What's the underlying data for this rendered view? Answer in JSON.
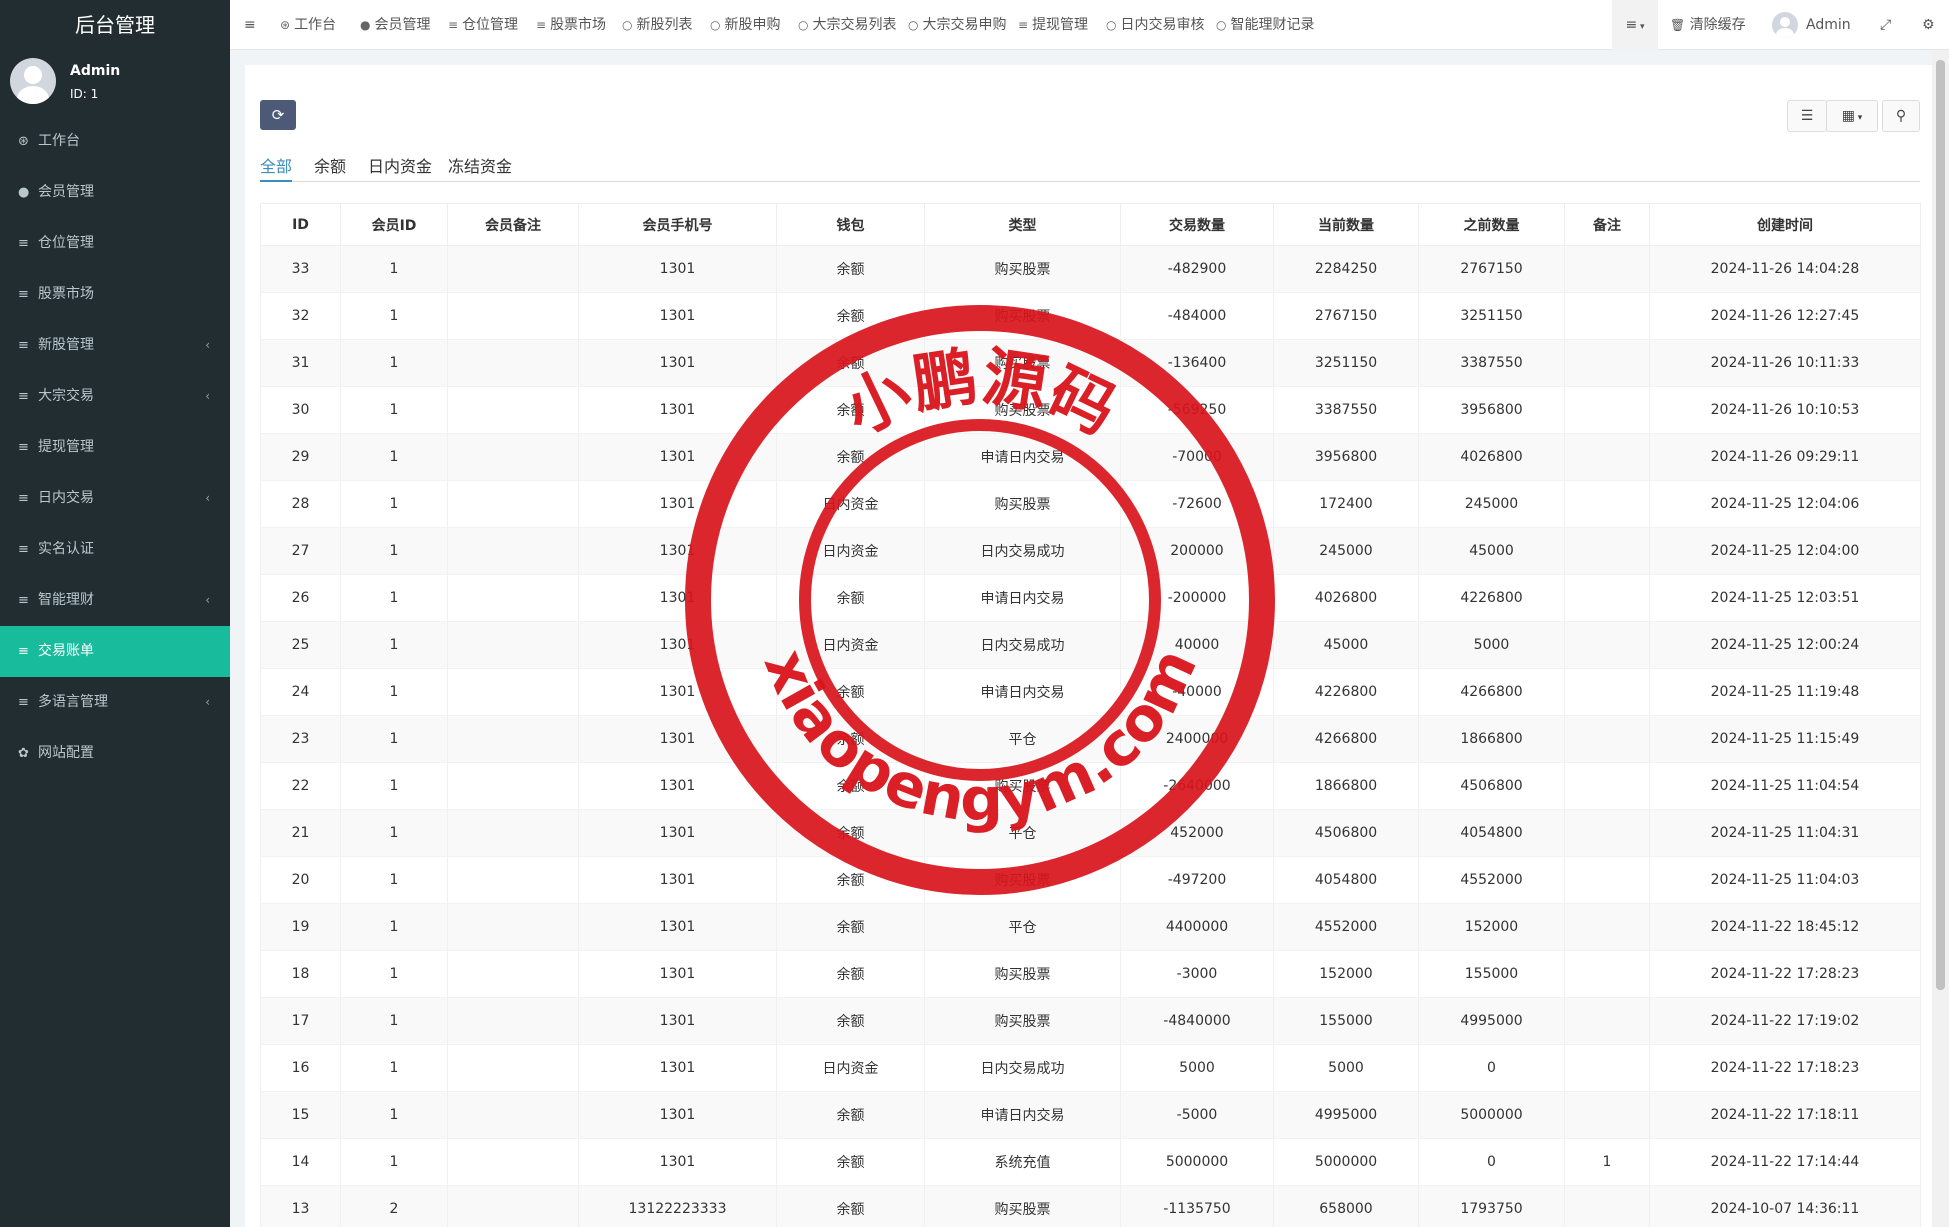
{
  "sidebar": {
    "brand": "后台管理",
    "user": {
      "name": "Admin",
      "id_label": "ID: 1"
    },
    "items": [
      {
        "label": "工作台",
        "icon": "dashboard-icon",
        "glyph": "⊛",
        "caret": false,
        "active": false
      },
      {
        "label": "会员管理",
        "icon": "user-circle-icon",
        "glyph": "●",
        "caret": false,
        "active": false
      },
      {
        "label": "仓位管理",
        "icon": "list-icon",
        "glyph": "≡",
        "caret": false,
        "active": false
      },
      {
        "label": "股票市场",
        "icon": "list-icon",
        "glyph": "≡",
        "caret": false,
        "active": false
      },
      {
        "label": "新股管理",
        "icon": "list-icon",
        "glyph": "≡",
        "caret": true,
        "active": false
      },
      {
        "label": "大宗交易",
        "icon": "list-icon",
        "glyph": "≡",
        "caret": true,
        "active": false
      },
      {
        "label": "提现管理",
        "icon": "list-icon",
        "glyph": "≡",
        "caret": false,
        "active": false
      },
      {
        "label": "日内交易",
        "icon": "list-icon",
        "glyph": "≡",
        "caret": true,
        "active": false
      },
      {
        "label": "实名认证",
        "icon": "list-icon",
        "glyph": "≡",
        "caret": false,
        "active": false
      },
      {
        "label": "智能理财",
        "icon": "list-icon",
        "glyph": "≡",
        "caret": true,
        "active": false
      },
      {
        "label": "交易账单",
        "icon": "list-icon",
        "glyph": "≡",
        "caret": false,
        "active": true
      },
      {
        "label": "多语言管理",
        "icon": "list-icon",
        "glyph": "≡",
        "caret": true,
        "active": false
      },
      {
        "label": "网站配置",
        "icon": "gear-icon",
        "glyph": "✿",
        "caret": false,
        "active": false
      }
    ]
  },
  "topnav": {
    "items": [
      {
        "label": "工作台",
        "icon": "dashboard-icon",
        "glyph": "⊛"
      },
      {
        "label": "会员管理",
        "icon": "user-circle-icon",
        "glyph": "●"
      },
      {
        "label": "仓位管理",
        "icon": "list-icon",
        "glyph": "≡"
      },
      {
        "label": "股票市场",
        "icon": "list-icon",
        "glyph": "≡"
      },
      {
        "label": "新股列表",
        "icon": "circle-icon",
        "glyph": "○"
      },
      {
        "label": "新股申购",
        "icon": "circle-icon",
        "glyph": "○"
      },
      {
        "label": "大宗交易列表",
        "icon": "circle-icon",
        "glyph": "○"
      },
      {
        "label": "大宗交易申购",
        "icon": "circle-icon",
        "glyph": "○"
      },
      {
        "label": "提现管理",
        "icon": "list-icon",
        "glyph": "≡"
      },
      {
        "label": "日内交易审核",
        "icon": "circle-icon",
        "glyph": "○"
      },
      {
        "label": "智能理财记录",
        "icon": "circle-icon",
        "glyph": "○"
      }
    ],
    "clear_cache": "清除缓存",
    "admin": "Admin"
  },
  "tabs": [
    "全部",
    "余额",
    "日内资金",
    "冻结资金"
  ],
  "table": {
    "columns": [
      "ID",
      "会员ID",
      "会员备注",
      "会员手机号",
      "钱包",
      "类型",
      "交易数量",
      "当前数量",
      "之前数量",
      "备注",
      "创建时间"
    ],
    "rows": [
      [
        "33",
        "1",
        "",
        "1301",
        "余额",
        "购买股票",
        "-482900",
        "2284250",
        "2767150",
        "",
        "2024-11-26 14:04:28"
      ],
      [
        "32",
        "1",
        "",
        "1301",
        "余额",
        "购买股票",
        "-484000",
        "2767150",
        "3251150",
        "",
        "2024-11-26 12:27:45"
      ],
      [
        "31",
        "1",
        "",
        "1301",
        "余额",
        "购买股票",
        "-136400",
        "3251150",
        "3387550",
        "",
        "2024-11-26 10:11:33"
      ],
      [
        "30",
        "1",
        "",
        "1301",
        "余额",
        "购买股票",
        "-569250",
        "3387550",
        "3956800",
        "",
        "2024-11-26 10:10:53"
      ],
      [
        "29",
        "1",
        "",
        "1301",
        "余额",
        "申请日内交易",
        "-70000",
        "3956800",
        "4026800",
        "",
        "2024-11-26 09:29:11"
      ],
      [
        "28",
        "1",
        "",
        "1301",
        "日内资金",
        "购买股票",
        "-72600",
        "172400",
        "245000",
        "",
        "2024-11-25 12:04:06"
      ],
      [
        "27",
        "1",
        "",
        "1301",
        "日内资金",
        "日内交易成功",
        "200000",
        "245000",
        "45000",
        "",
        "2024-11-25 12:04:00"
      ],
      [
        "26",
        "1",
        "",
        "1301",
        "余额",
        "申请日内交易",
        "-200000",
        "4026800",
        "4226800",
        "",
        "2024-11-25 12:03:51"
      ],
      [
        "25",
        "1",
        "",
        "1301",
        "日内资金",
        "日内交易成功",
        "40000",
        "45000",
        "5000",
        "",
        "2024-11-25 12:00:24"
      ],
      [
        "24",
        "1",
        "",
        "1301",
        "余额",
        "申请日内交易",
        "-40000",
        "4226800",
        "4266800",
        "",
        "2024-11-25 11:19:48"
      ],
      [
        "23",
        "1",
        "",
        "1301",
        "余额",
        "平仓",
        "2400000",
        "4266800",
        "1866800",
        "",
        "2024-11-25 11:15:49"
      ],
      [
        "22",
        "1",
        "",
        "1301",
        "余额",
        "购买股票",
        "-2640000",
        "1866800",
        "4506800",
        "",
        "2024-11-25 11:04:54"
      ],
      [
        "21",
        "1",
        "",
        "1301",
        "余额",
        "平仓",
        "452000",
        "4506800",
        "4054800",
        "",
        "2024-11-25 11:04:31"
      ],
      [
        "20",
        "1",
        "",
        "1301",
        "余额",
        "购买股票",
        "-497200",
        "4054800",
        "4552000",
        "",
        "2024-11-25 11:04:03"
      ],
      [
        "19",
        "1",
        "",
        "1301",
        "余额",
        "平仓",
        "4400000",
        "4552000",
        "152000",
        "",
        "2024-11-22 18:45:12"
      ],
      [
        "18",
        "1",
        "",
        "1301",
        "余额",
        "购买股票",
        "-3000",
        "152000",
        "155000",
        "",
        "2024-11-22 17:28:23"
      ],
      [
        "17",
        "1",
        "",
        "1301",
        "余额",
        "购买股票",
        "-4840000",
        "155000",
        "4995000",
        "",
        "2024-11-22 17:19:02"
      ],
      [
        "16",
        "1",
        "",
        "1301",
        "日内资金",
        "日内交易成功",
        "5000",
        "5000",
        "0",
        "",
        "2024-11-22 17:18:23"
      ],
      [
        "15",
        "1",
        "",
        "1301",
        "余额",
        "申请日内交易",
        "-5000",
        "4995000",
        "5000000",
        "",
        "2024-11-22 17:18:11"
      ],
      [
        "14",
        "1",
        "",
        "1301",
        "余额",
        "系统充值",
        "5000000",
        "5000000",
        "0",
        "1",
        "2024-11-22 17:14:44"
      ],
      [
        "13",
        "2",
        "",
        "13122223333",
        "余额",
        "购买股票",
        "-1135750",
        "658000",
        "1793750",
        "",
        "2024-10-07 14:36:11"
      ]
    ]
  },
  "watermark": {
    "top_text": "小鹏源码",
    "bottom_text": "xiaopengym.com",
    "color": "#d9141b"
  },
  "colors": {
    "sidebar_bg": "#222d32",
    "active_item": "#18bc9c",
    "refresh_btn": "#4c5a77",
    "tab_active": "#3c8dbc"
  }
}
